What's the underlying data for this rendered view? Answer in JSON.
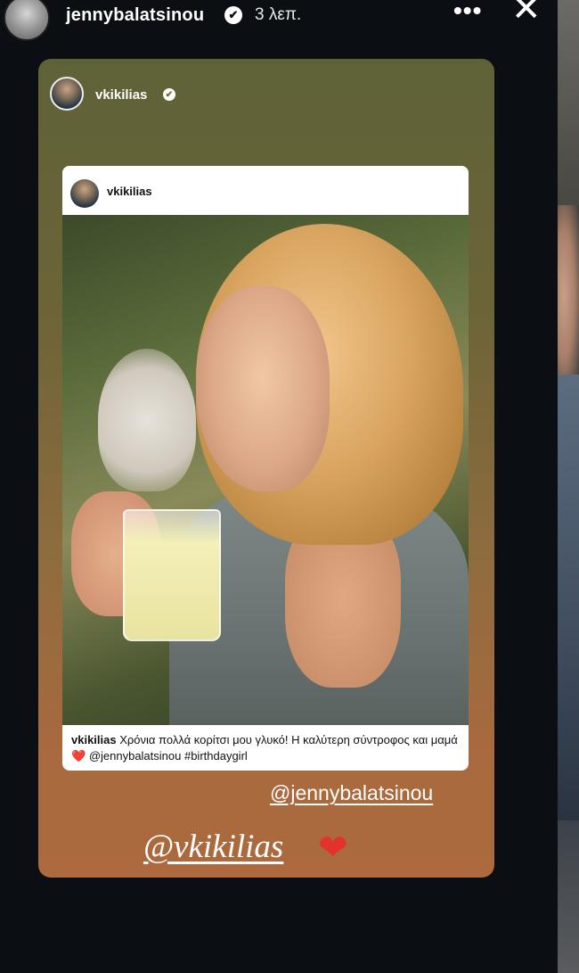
{
  "header": {
    "username": "jennybalatsinou",
    "verified_icon": "✔",
    "time": "3 λεπ.",
    "more_label": "•••",
    "close_label": "✕"
  },
  "story": {
    "reshared_by": "vkikilias",
    "verified_icon": "✔",
    "post": {
      "username": "vkikilias",
      "caption_user": "vkikilias",
      "caption_text": "Χρόνια πολλά κορίτσι μου γλυκό! Η καλύτερη σύντροφος και μαμά",
      "caption_heart": "❤️",
      "caption_tags": "@jennybalatsinou  #birthdaygirl"
    },
    "mention_1": "@jennybalatsinou",
    "mention_2": "@vkikilias",
    "mention_heart": "❤"
  },
  "colors": {
    "background": "#0b0f14",
    "card_top": "#5f6238",
    "card_bottom": "#ac6a3e",
    "heart": "#e3312b"
  }
}
